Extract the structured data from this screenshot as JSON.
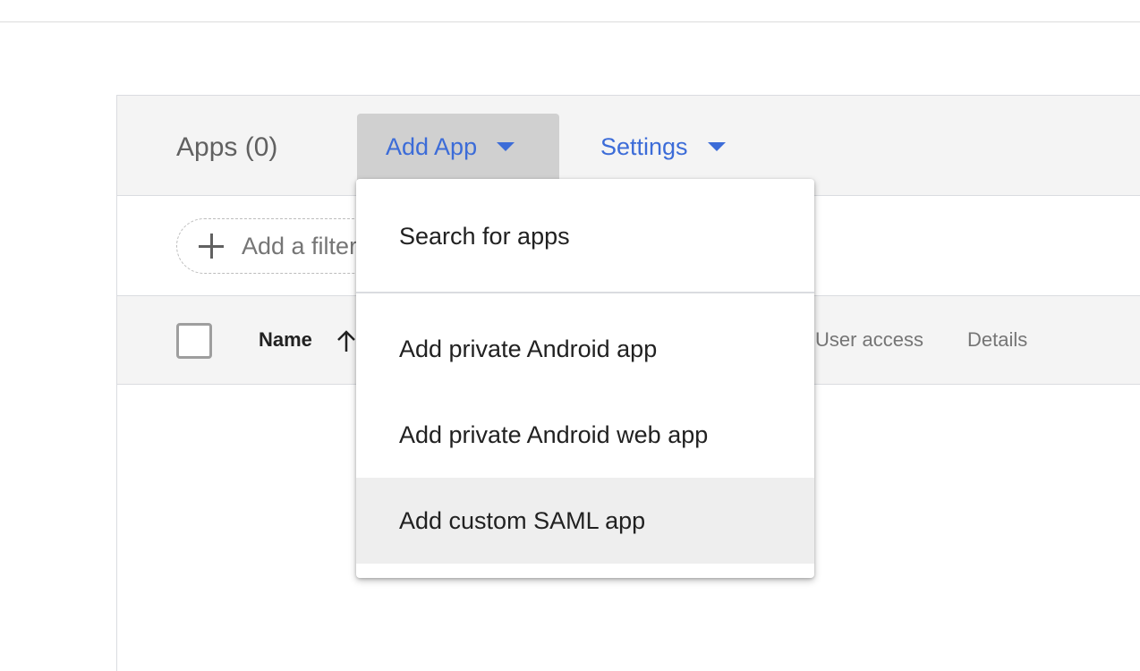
{
  "header": {
    "apps_title": "Apps (0)",
    "add_app_label": "Add App",
    "settings_label": "Settings"
  },
  "filter": {
    "label": "Add a filter"
  },
  "table": {
    "columns": {
      "name": "Name",
      "user_access": "User access",
      "details": "Details"
    }
  },
  "add_app_menu": {
    "items": [
      {
        "label": "Search for apps"
      },
      {
        "label": "Add private Android app"
      },
      {
        "label": "Add private Android web app"
      },
      {
        "label": "Add custom SAML app"
      }
    ]
  },
  "colors": {
    "accent": "#3c6cd8",
    "header_bg": "#f4f4f4",
    "active_button_bg": "#d0d0d0",
    "menu_hover_bg": "#eeeeee"
  },
  "icons": [
    "plus-icon",
    "caret-down-icon",
    "arrow-up-icon",
    "checkbox-icon"
  ]
}
